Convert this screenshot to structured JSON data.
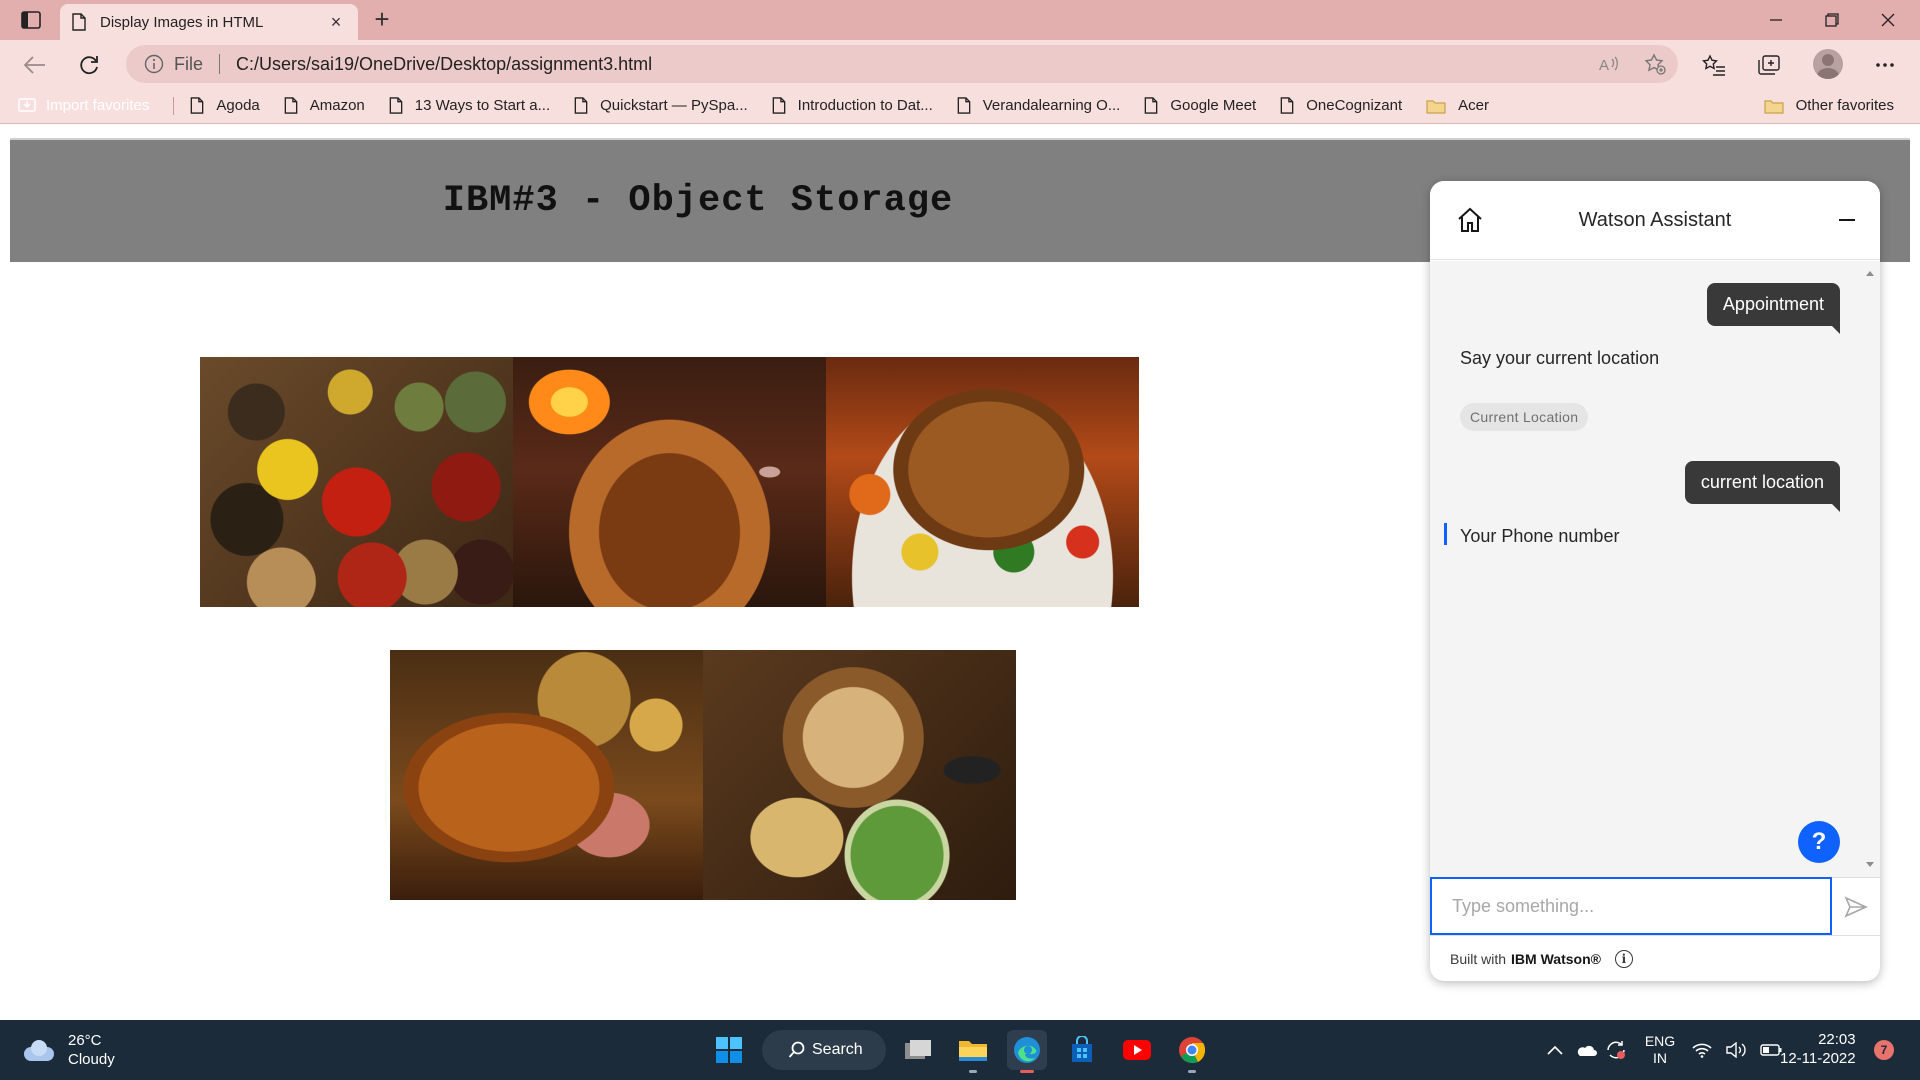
{
  "browser": {
    "tab": {
      "title": "Display Images in HTML",
      "close_symbol": "×"
    },
    "new_tab_symbol": "+",
    "address": {
      "scheme_label": "File",
      "url": "C:/Users/sai19/OneDrive/Desktop/assignment3.html"
    },
    "favorites": [
      {
        "label": "Import favorites",
        "icon": "import-icon"
      },
      {
        "label": "Agoda",
        "icon": "page-icon"
      },
      {
        "label": "Amazon",
        "icon": "page-icon"
      },
      {
        "label": "13 Ways to Start a...",
        "icon": "page-icon"
      },
      {
        "label": "Quickstart — PySpa...",
        "icon": "page-icon"
      },
      {
        "label": "Introduction to Dat...",
        "icon": "page-icon"
      },
      {
        "label": "Verandalearning O...",
        "icon": "page-icon"
      },
      {
        "label": "Google Meet",
        "icon": "page-icon"
      },
      {
        "label": "OneCognizant",
        "icon": "page-icon"
      },
      {
        "label": "Acer",
        "icon": "folder-icon"
      }
    ],
    "other_favorites": "Other favorites"
  },
  "page": {
    "heading": "IBM#3 - Object Storage"
  },
  "assistant": {
    "title": "Watson Assistant",
    "messages": {
      "user_1": "Appointment",
      "bot_1": "Say your current location",
      "chip_1": "Current Location",
      "user_2": "current location",
      "bot_2": "Your Phone number"
    },
    "help_symbol": "?",
    "input_placeholder": "Type something...",
    "footer_prefix": "Built with",
    "footer_brand": "IBM Watson®",
    "info_symbol": "i"
  },
  "taskbar": {
    "weather_temp": "26°C",
    "weather_cond": "Cloudy",
    "search_label": "Search",
    "lang_top": "ENG",
    "lang_bottom": "IN",
    "time": "22:03",
    "date": "12-11-2022",
    "notifications": "7"
  },
  "colors": {
    "tabbar": "#e2aeae",
    "toolbar": "#f7dfde",
    "hero": "#808080",
    "watson_blue": "#0f62fe",
    "taskbar": "#1c2b3a"
  }
}
